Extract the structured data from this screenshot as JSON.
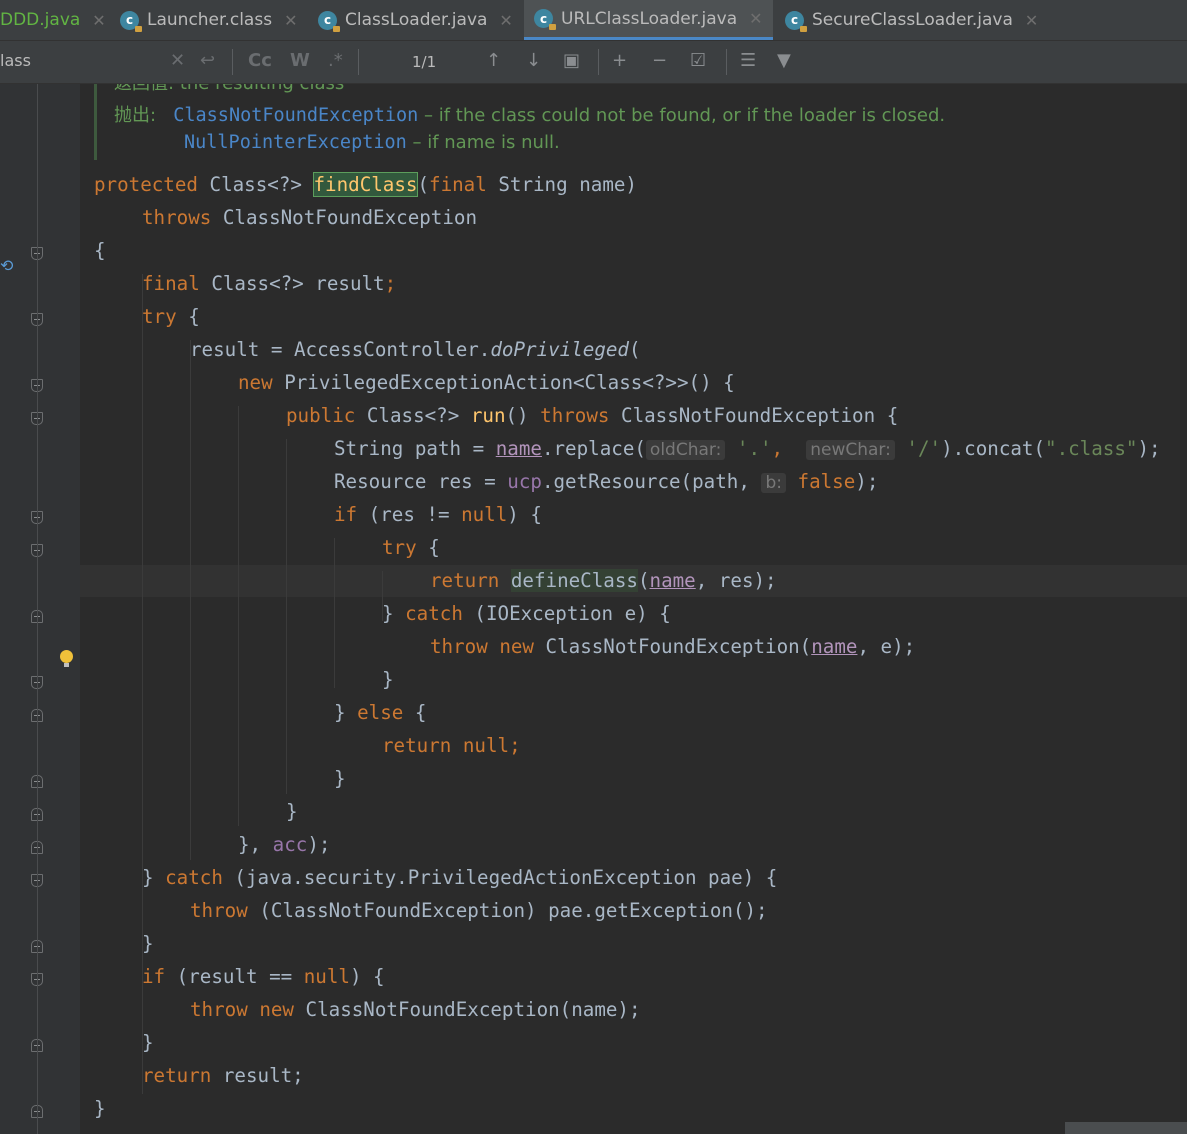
{
  "tabs": [
    {
      "label": "DDD.java",
      "icon": "none",
      "active": false
    },
    {
      "label": "Launcher.class",
      "icon": "class-icon",
      "active": false
    },
    {
      "label": "ClassLoader.java",
      "icon": "class-icon",
      "active": false
    },
    {
      "label": "URLClassLoader.java",
      "icon": "class-icon",
      "active": true
    },
    {
      "label": "SecureClassLoader.java",
      "icon": "class-icon",
      "active": false
    }
  ],
  "search": {
    "query": "lass",
    "match_count": "1/1",
    "toggles": [
      "Cc",
      "W",
      ".*"
    ]
  },
  "doc": {
    "returns_prefix": "返回值:",
    "returns_text": "the resulting class",
    "throws_label": "抛出:",
    "ex1": "ClassNotFoundException",
    "ex1_desc": " – if the class could not be found, or if the loader is closed.",
    "ex2": "NullPointerException",
    "ex2_desc": " – if name is null."
  },
  "code": {
    "l01_kw": "protected",
    "l01_a": " Class<?> ",
    "l01_fn": "findClass",
    "l01_b": "(",
    "l01_kw2": "final",
    "l01_c": " String name)",
    "l02_kw": "throws",
    "l02_a": " ClassNotFoundException",
    "l03": "{",
    "l04_kw": "final",
    "l04_a": " Class<?> result",
    "l04_semi": ";",
    "l05_kw": "try",
    "l05_a": " {",
    "l06_a": "result = AccessController.",
    "l06_it": "doPrivileged",
    "l06_b": "(",
    "l07_kw": "new",
    "l07_a": " PrivilegedExceptionAction<Class<?>>() {",
    "l08_kw": "public",
    "l08_a": " Class<?> ",
    "l08_fn": "run",
    "l08_b": "() ",
    "l08_kw2": "throws",
    "l08_c": " ClassNotFoundException {",
    "l09_a": "String path = ",
    "l09_name": "name",
    "l09_b": ".replace(",
    "l09_h1": "oldChar:",
    "l09_s1": "'.'",
    "l09_comma": ",",
    "l09_h2": "newChar:",
    "l09_s2": "'/'",
    "l09_c": ").concat(",
    "l09_s3": "\".class\"",
    "l09_d": ");",
    "l10_a": "Resource res = ",
    "l10_fld": "ucp",
    "l10_b": ".getResource(path, ",
    "l10_h": "b:",
    "l10_kw": "false",
    "l10_c": ");",
    "l11_kw": "if",
    "l11_a": " (res != ",
    "l11_kw2": "null",
    "l11_b": ") {",
    "l12_kw": "try",
    "l12_a": " {",
    "l13_kw": "return",
    "l13_fn": "defineClass",
    "l13_a": "(",
    "l13_name": "name",
    "l13_b": ", res);",
    "l14_a": "} ",
    "l14_kw": "catch",
    "l14_b": " (IOException e) {",
    "l15_kw": "throw",
    "l15_kw2": "new",
    "l15_a": " ClassNotFoundException(",
    "l15_name": "name",
    "l15_b": ", e);",
    "l16": "}",
    "l17_a": "} ",
    "l17_kw": "else",
    "l17_b": " {",
    "l18_kw": "return",
    "l18_kw2": "null",
    "l18_semi": ";",
    "l19": "}",
    "l20": "}",
    "l21_a": "}, ",
    "l21_fld": "acc",
    "l21_b": ");",
    "l22_a": "} ",
    "l22_kw": "catch",
    "l22_b": " (java.security.PrivilegedActionException pae) {",
    "l23_kw": "throw",
    "l23_a": " (ClassNotFoundException) pae.getException();",
    "l24": "}",
    "l25_kw": "if",
    "l25_a": " (result == ",
    "l25_kw2": "null",
    "l25_b": ") {",
    "l26_kw": "throw",
    "l26_kw2": "new",
    "l26_a": " ClassNotFoundException(name);",
    "l27": "}",
    "l28_kw": "return",
    "l28_a": " result;",
    "l29": "}"
  },
  "colors": {
    "background": "#2b2b2b",
    "keyword": "#cc7832",
    "method": "#ffc66d",
    "string": "#6a8759",
    "field": "#9876aa",
    "doc": "#629755",
    "accent": "#4a88c7"
  }
}
